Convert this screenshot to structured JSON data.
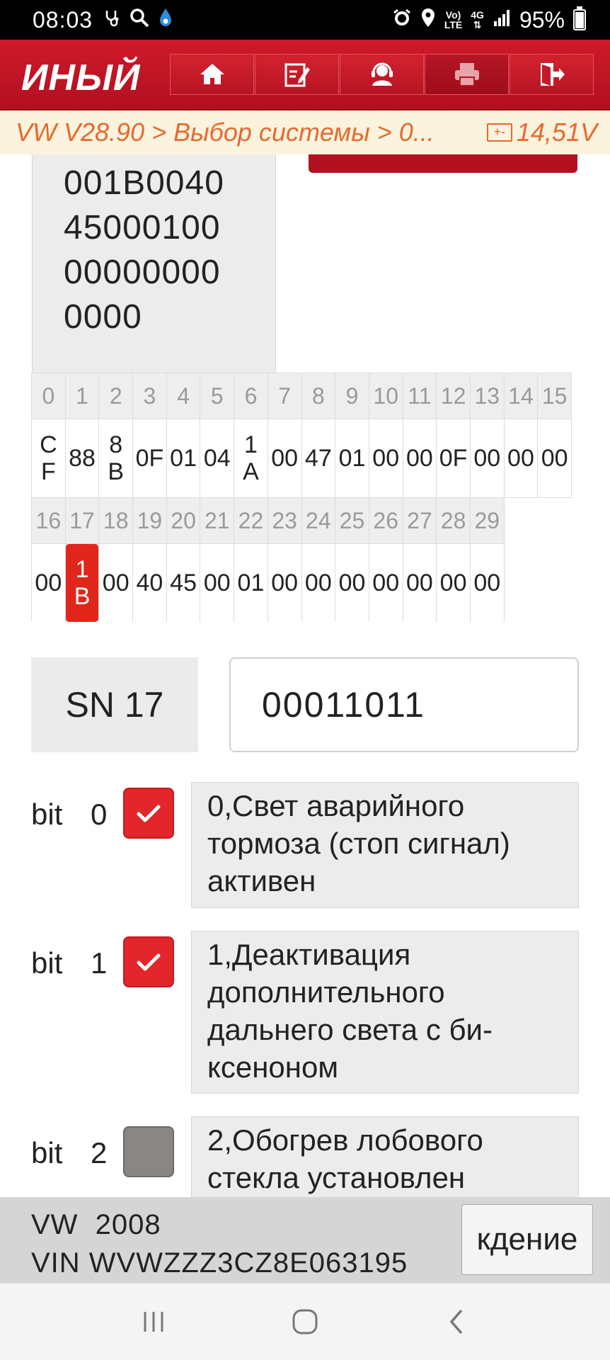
{
  "status_bar": {
    "time": "08:03",
    "icons_left": [
      "stethoscope-icon",
      "search-icon",
      "drop-icon"
    ],
    "icons_right": [
      "alarm-icon",
      "location-icon"
    ],
    "volte_top": "Vo)",
    "volte_bottom": "LTE",
    "network": "4G",
    "battery": "95%"
  },
  "header": {
    "title": "ИНЫЙ",
    "nav": [
      {
        "name": "home",
        "icon": "home-icon"
      },
      {
        "name": "report",
        "icon": "edit-report-icon"
      },
      {
        "name": "support",
        "icon": "support-agent-icon"
      },
      {
        "name": "print",
        "icon": "printer-icon",
        "active": true
      },
      {
        "name": "exit",
        "icon": "exit-icon"
      }
    ],
    "colors": {
      "primary": "#c4182a",
      "breadcrumb_text": "#e66a2e",
      "highlight": "#e1261c"
    }
  },
  "breadcrumb": {
    "path": "VW V28.90 > Выбор системы > 0...",
    "voltage": "14,51V",
    "battery_icon_label": "+-"
  },
  "hex_box": {
    "lines": [
      "001B0040",
      "45000100",
      "00000000",
      "0000"
    ]
  },
  "byte_table": {
    "row1": {
      "indices": [
        "0",
        "1",
        "2",
        "3",
        "4",
        "5",
        "6",
        "7",
        "8",
        "9",
        "10",
        "11",
        "12",
        "13",
        "14",
        "15"
      ],
      "values": [
        {
          "top": "C",
          "bottom": "F"
        },
        {
          "text": "88"
        },
        {
          "top": "8",
          "bottom": "B"
        },
        {
          "text": "0F"
        },
        {
          "text": "01"
        },
        {
          "text": "04"
        },
        {
          "top": "1",
          "bottom": "A"
        },
        {
          "text": "00"
        },
        {
          "text": "47"
        },
        {
          "text": "01"
        },
        {
          "text": "00"
        },
        {
          "text": "00"
        },
        {
          "text": "0F"
        },
        {
          "text": "00"
        },
        {
          "text": "00"
        },
        {
          "text": "00"
        }
      ]
    },
    "row2": {
      "indices": [
        "16",
        "17",
        "18",
        "19",
        "20",
        "21",
        "22",
        "23",
        "24",
        "25",
        "26",
        "27",
        "28",
        "29"
      ],
      "values": [
        {
          "text": "00"
        },
        {
          "top": "1",
          "bottom": "B",
          "selected": true
        },
        {
          "text": "00"
        },
        {
          "text": "40"
        },
        {
          "text": "45"
        },
        {
          "text": "00"
        },
        {
          "text": "01"
        },
        {
          "text": "00"
        },
        {
          "text": "00"
        },
        {
          "text": "00"
        },
        {
          "text": "00"
        },
        {
          "text": "00"
        },
        {
          "text": "00"
        },
        {
          "text": "00"
        }
      ]
    }
  },
  "sn": {
    "label": "SN 17",
    "value": "00011011"
  },
  "bits": [
    {
      "label": "bit",
      "num": "0",
      "checked": true,
      "desc": "0,Свет аварийного тормоза (стоп сигнал) активен"
    },
    {
      "label": "bit",
      "num": "1",
      "checked": true,
      "desc": "1,Деактивация дополнительного дальнего света с би-ксеноном"
    },
    {
      "label": "bit",
      "num": "2",
      "checked": false,
      "desc": "2,Обогрев лобового стекла установлен"
    }
  ],
  "footer": {
    "make_year": "VW  2008",
    "vin": "VIN WVWZZZ3CZ8E063195",
    "button": "кдение"
  },
  "system_nav": [
    "recents-icon",
    "home-circle-icon",
    "back-icon"
  ]
}
